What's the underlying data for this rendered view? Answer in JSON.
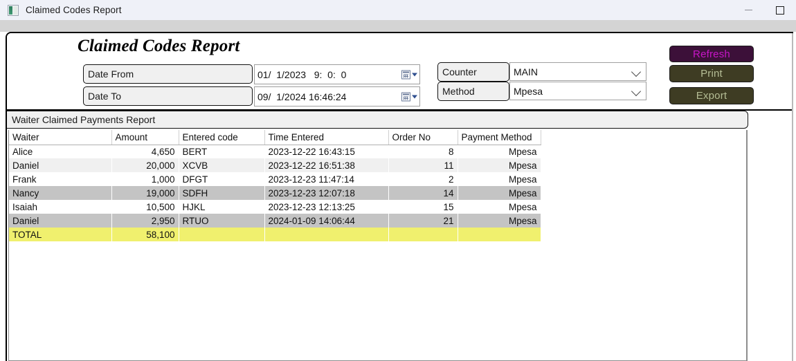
{
  "window": {
    "title": "Claimed Codes Report",
    "icon": "app-icon",
    "minimize_label": "minimize-icon",
    "maximize_label": "maximize-icon"
  },
  "form": {
    "title": "Claimed Codes Report"
  },
  "filters": {
    "date_from_label": "Date From",
    "date_from_value": "01/  1/2023   9:  0:  0",
    "date_to_label": "Date  To",
    "date_to_value": "09/  1/2024 16:46:24",
    "counter_label": "Counter",
    "counter_value": "MAIN",
    "method_label": "Method",
    "method_value": "Mpesa"
  },
  "actions": {
    "refresh_label": "Refresh",
    "print_label": "Print",
    "export_label": "Export"
  },
  "report": {
    "section_title": "Waiter Claimed Payments Report",
    "columns": [
      "Waiter",
      "Amount",
      "Entered code",
      "Time Entered",
      "Order No",
      "Payment Method"
    ],
    "rows": [
      {
        "waiter": "Alice",
        "amount": "4,650",
        "code": "BERT",
        "time": "2023-12-22 16:43:15",
        "order": "8",
        "method": "Mpesa",
        "style": "normal"
      },
      {
        "waiter": "Daniel",
        "amount": "20,000",
        "code": "XCVB",
        "time": "2023-12-22 16:51:38",
        "order": "11",
        "method": "Mpesa",
        "style": "alt"
      },
      {
        "waiter": "Frank",
        "amount": "1,000",
        "code": "DFGT",
        "time": "2023-12-23 11:47:14",
        "order": "2",
        "method": "Mpesa",
        "style": "normal"
      },
      {
        "waiter": "Nancy",
        "amount": "19,000",
        "code": "SDFH",
        "time": "2023-12-23 12:07:18",
        "order": "14",
        "method": "Mpesa",
        "style": "selected"
      },
      {
        "waiter": "Isaiah",
        "amount": "10,500",
        "code": "HJKL",
        "time": "2023-12-23 12:13:25",
        "order": "15",
        "method": "Mpesa",
        "style": "normal"
      },
      {
        "waiter": "Daniel",
        "amount": "2,950",
        "code": "RTUO",
        "time": "2024-01-09 14:06:44",
        "order": "21",
        "method": "Mpesa",
        "style": "selected"
      }
    ],
    "total": {
      "label": "TOTAL",
      "amount": "58,100",
      "code": "",
      "time": "",
      "order": "",
      "method": ""
    }
  },
  "colors": {
    "titlebar_bg": "#eff1f8",
    "strip_bg": "#d4d4d4",
    "refresh_bg": "#3c1039",
    "refresh_fg": "#c815c8",
    "print_bg": "#3e3c23",
    "print_fg": "#b5bd95",
    "selected_row": "#c4c4c4",
    "alt_row": "#f0f0f0",
    "total_row": "#f0f06e"
  }
}
